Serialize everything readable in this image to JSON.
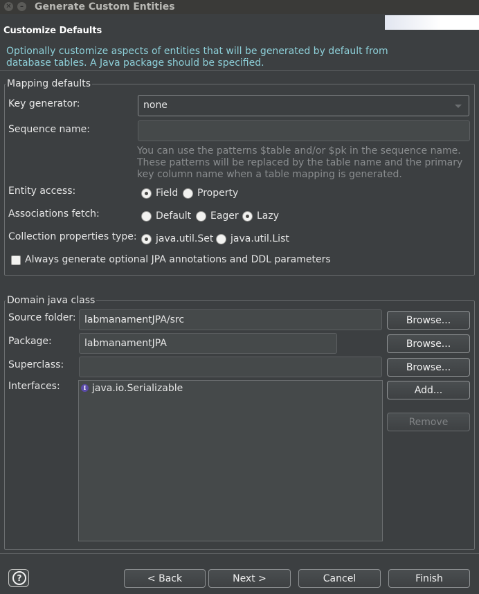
{
  "window": {
    "title": "Generate Custom Entities",
    "close_glyph": "✕",
    "min_glyph": "–"
  },
  "header": {
    "page_title": "Customize Defaults",
    "description": "Optionally customize aspects of entities that will be generated by default from database tables. A Java package should be specified."
  },
  "mapping": {
    "legend": "Mapping defaults",
    "key_generator_label": "Key generator:",
    "key_generator_value": "none",
    "sequence_name_label": "Sequence name:",
    "sequence_name_value": "",
    "sequence_hint": "You can use the patterns $table and/or $pk in the sequence name. These patterns will be replaced by the table name and the primary key column name when a table mapping is generated.",
    "entity_access_label": "Entity access:",
    "entity_access_options": [
      "Field",
      "Property"
    ],
    "entity_access_selected": "Field",
    "associations_fetch_label": "Associations fetch:",
    "associations_fetch_options": [
      "Default",
      "Eager",
      "Lazy"
    ],
    "associations_fetch_selected": "Lazy",
    "collection_type_label": "Collection properties type:",
    "collection_type_options": [
      "java.util.Set",
      "java.util.List"
    ],
    "collection_type_selected": "java.util.Set",
    "always_generate_label": "Always generate optional JPA annotations and DDL parameters",
    "always_generate_checked": false
  },
  "domain": {
    "legend": "Domain java class",
    "source_folder_label": "Source folder:",
    "source_folder_value": "labmanamentJPA/src",
    "package_label": "Package:",
    "package_value": "labmanamentJPA",
    "superclass_label": "Superclass:",
    "superclass_value": "",
    "interfaces_label": "Interfaces:",
    "interfaces": [
      "java.io.Serializable"
    ],
    "interface_icon_glyph": "I",
    "browse_label": "Browse...",
    "add_label": "Add...",
    "remove_label": "Remove"
  },
  "footer": {
    "help_glyph": "?",
    "back_label": "< Back",
    "next_label": "Next >",
    "cancel_label": "Cancel",
    "finish_label": "Finish"
  },
  "colors": {
    "background": "#3c3f41",
    "description_text": "#8dcfd8",
    "hint_text": "#8a8d8f"
  }
}
